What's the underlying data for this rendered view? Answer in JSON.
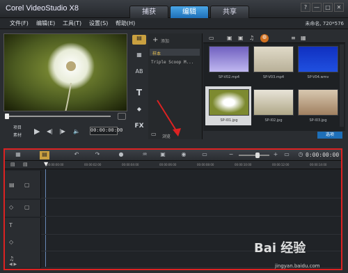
{
  "app": {
    "title": "Corel VideoStudio X8",
    "project": "未命名, 720*576"
  },
  "tabs": [
    {
      "label": "捕获"
    },
    {
      "label": "编辑"
    },
    {
      "label": "共享"
    }
  ],
  "window_buttons": [
    "?",
    "—",
    "□",
    "✕"
  ],
  "menu": [
    "文件(F)",
    "编辑(E)",
    "工具(T)",
    "设置(S)",
    "帮助(H)"
  ],
  "preview": {
    "mode_labels": [
      "项目",
      "素材"
    ],
    "timecode": "00:00:00:00"
  },
  "library": {
    "add_label": "添加",
    "folders": [
      "样本",
      "Triple Scoop M..."
    ],
    "browse_label": "浏览",
    "options_label": "选项",
    "thumbnails": [
      {
        "label": "SP-V02.mp4"
      },
      {
        "label": "SP-V03.mp4"
      },
      {
        "label": "SP-V04.wmv"
      },
      {
        "label": "SP-I01.jpg"
      },
      {
        "label": "SP-I02.jpg"
      },
      {
        "label": "SP-I03.jpg"
      }
    ]
  },
  "timeline": {
    "timecode": "0:00:00:00",
    "ruler": [
      "00:00:00:00",
      "00:00:02:00",
      "00:00:04:00",
      "00:00:06:00",
      "00:00:08:00",
      "00:00:10:00",
      "00:00:12:00",
      "00:00:14:00"
    ]
  },
  "watermark": {
    "brand": "Bai 经验",
    "url": "jingyan.baidu.com"
  },
  "colors": {
    "accent": "#1e6fb8",
    "annotation": "#dd2222"
  }
}
